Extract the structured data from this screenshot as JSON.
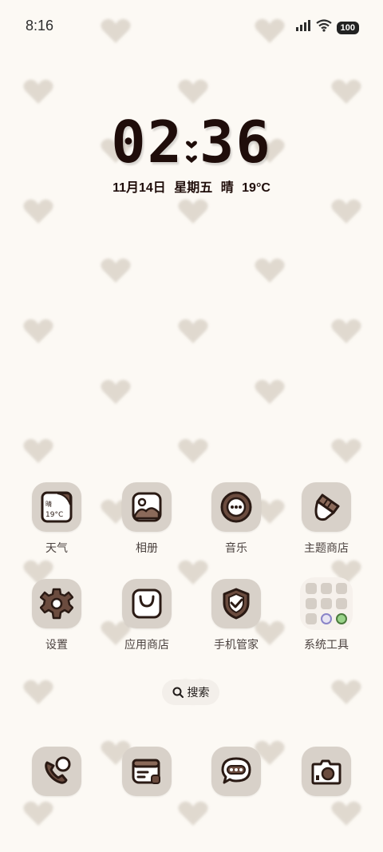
{
  "status_bar": {
    "time": "8:16",
    "battery": "100"
  },
  "lock_clock": {
    "hours": "02",
    "minutes": "36",
    "date_text": "11月14日  星期五  晴  19°C"
  },
  "weather_icon": {
    "condition": "晴",
    "temp": "19°C"
  },
  "apps_row1": [
    {
      "label": "天气",
      "icon": "weather-icon"
    },
    {
      "label": "相册",
      "icon": "gallery-icon"
    },
    {
      "label": "音乐",
      "icon": "music-icon"
    },
    {
      "label": "主题商店",
      "icon": "theme-store-icon"
    }
  ],
  "apps_row2": [
    {
      "label": "设置",
      "icon": "gear-icon"
    },
    {
      "label": "应用商店",
      "icon": "shopping-bag-icon"
    },
    {
      "label": "手机管家",
      "icon": "shield-check-icon"
    },
    {
      "label": "系统工具",
      "icon": "folder-icon"
    }
  ],
  "search": {
    "label": "搜索"
  },
  "dock": [
    {
      "icon": "phone-icon"
    },
    {
      "icon": "contacts-card-icon"
    },
    {
      "icon": "messages-icon"
    },
    {
      "icon": "camera-icon"
    }
  ],
  "colors": {
    "background": "#fcf9f4",
    "tile": "#d8d1c9",
    "ink": "#2a1a14",
    "heart": "#ddd6cc"
  }
}
